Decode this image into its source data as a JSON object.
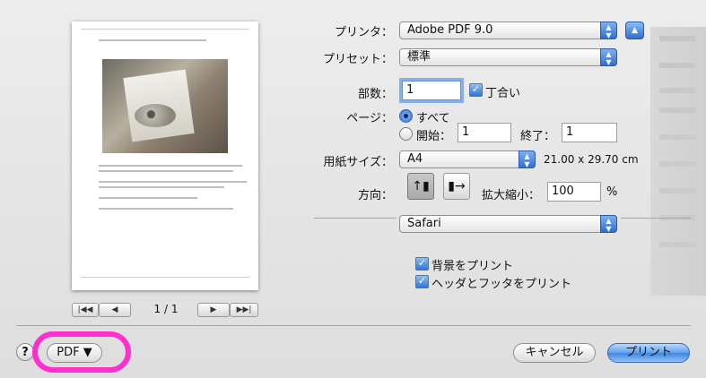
{
  "printer": {
    "label": "プリンタ：",
    "value": "Adobe PDF 9.0"
  },
  "preset": {
    "label": "プリセット：",
    "value": "標準"
  },
  "copies": {
    "label": "部数：",
    "value": "1",
    "collate_label": "丁合い",
    "collate_checked": true
  },
  "pages": {
    "label": "ページ：",
    "all_label": "すべて",
    "from_label": "開始：",
    "from_value": "1",
    "to_label": "終了：",
    "to_value": "1",
    "selected": "all"
  },
  "paper": {
    "label": "用紙サイズ：",
    "value": "A4",
    "dimensions": "21.00 x 29.70 cm"
  },
  "orientation": {
    "label": "方向：",
    "selected": "portrait"
  },
  "scale": {
    "label": "拡大縮小：",
    "value": "100",
    "unit": "%"
  },
  "section_popup": {
    "value": "Safari"
  },
  "options": [
    {
      "label": "背景をプリント",
      "checked": true
    },
    {
      "label": "ヘッダとフッタをプリント",
      "checked": true
    }
  ],
  "preview": {
    "page_indicator": "1 / 1"
  },
  "footer": {
    "help": "?",
    "pdf_label": "PDF ▼",
    "cancel_label": "キャンセル",
    "print_label": "プリント"
  },
  "colors": {
    "accent": "#3f85e2",
    "highlight_ring": "#ff2fd0"
  }
}
